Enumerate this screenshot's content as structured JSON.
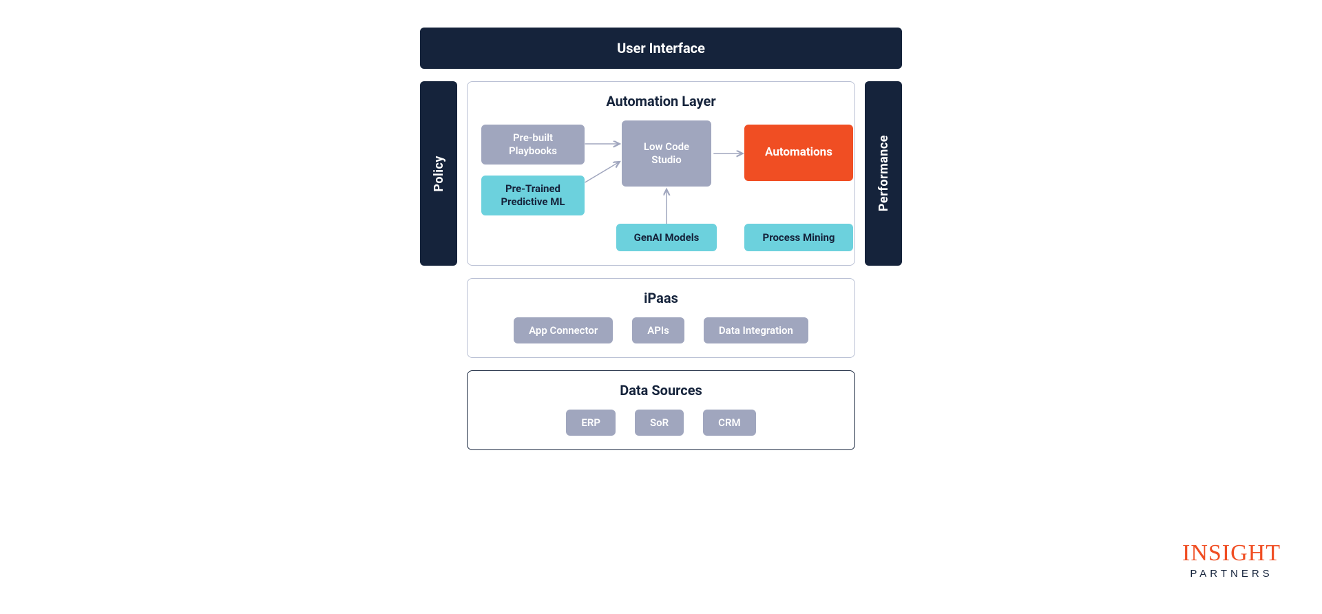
{
  "top_bar": "User Interface",
  "side_left": "Policy",
  "side_right": "Performance",
  "automation": {
    "title": "Automation Layer",
    "playbooks": "Pre-built\nPlaybooks",
    "predictive": "Pre-Trained\nPredictive ML",
    "studio": "Low Code\nStudio",
    "genai": "GenAI Models",
    "automations": "Automations",
    "process_mining": "Process Mining"
  },
  "ipaas": {
    "title": "iPaas",
    "items": [
      "App Connector",
      "APIs",
      "Data Integration"
    ]
  },
  "data_sources": {
    "title": "Data Sources",
    "items": [
      "ERP",
      "SoR",
      "CRM"
    ]
  },
  "logo": {
    "top": "INSIGHT",
    "bottom": "PARTNERS"
  },
  "colors": {
    "dark": "#15233b",
    "gray": "#a0a6be",
    "teal": "#6cd1dd",
    "orange": "#f04e23"
  }
}
